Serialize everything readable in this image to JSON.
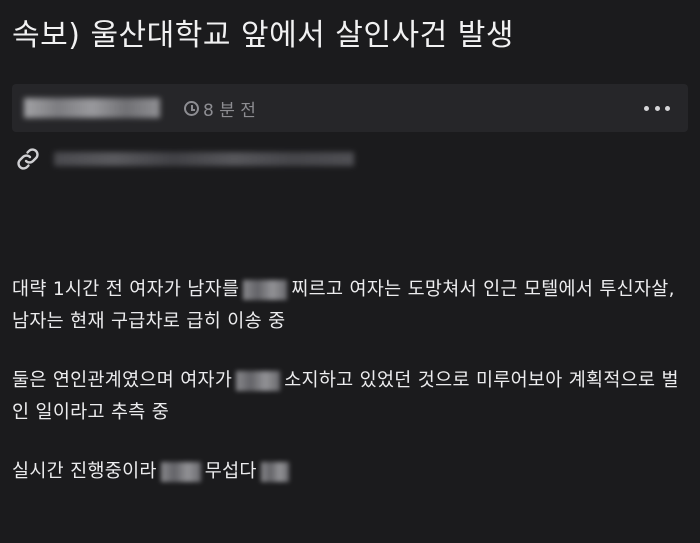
{
  "post": {
    "title": "속보) 울산대학교 앞에서 살인사건 발생",
    "time": "8 분 전"
  },
  "icons": {
    "clock": "clock-icon",
    "more": "more-options-icon",
    "link": "link-icon"
  },
  "content": {
    "p1_a": "대략 1시간 전 여자가 남자를",
    "p1_b": "찌르고 여자는 도망쳐서 인근 모텔에서 투신자살, 남자는 현재 구급차로 급히 이송 중",
    "p2_a": "둘은 연인관계였으며 여자가",
    "p2_b": "소지하고 있었던 것으로 미루어보아 계획적으로 벌인 일이라고 추측 중",
    "p3_a": "실시간 진행중이라",
    "p3_b": "무섭다"
  }
}
